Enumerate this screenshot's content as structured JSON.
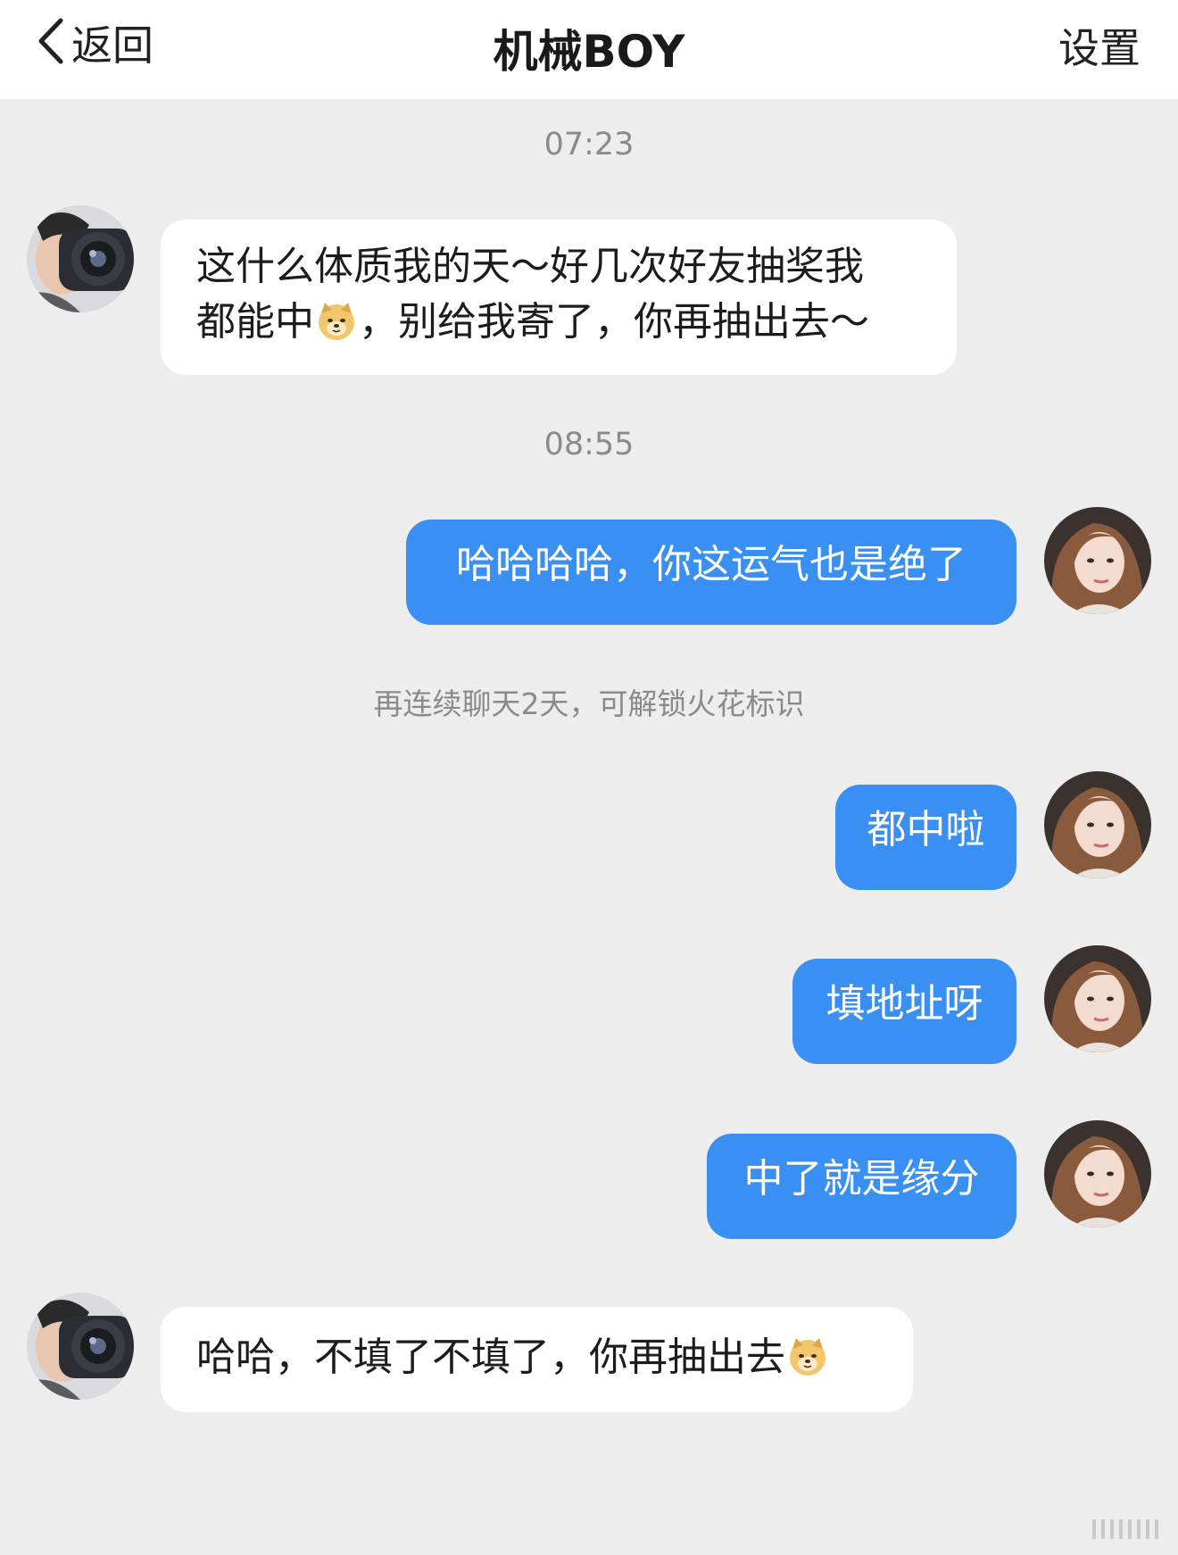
{
  "header": {
    "back_label": "返回",
    "title": "机械BOY",
    "settings_label": "设置"
  },
  "timestamps": [
    "07:23",
    "08:55"
  ],
  "system_notice": "再连续聊天2天，可解锁火花标识",
  "messages": [
    {
      "sender": "机械BOY",
      "lines": [
        "这什么体质我的天～好几次好友抽奖我",
        "都能中",
        "，别给我寄了，你再抽出去～"
      ]
    },
    {
      "sender": "me",
      "text": "哈哈哈哈，你这运气也是绝了"
    },
    {
      "sender": "me",
      "text": "都中啦"
    },
    {
      "sender": "me",
      "text": "填地址呀"
    },
    {
      "sender": "me",
      "text": "中了就是缘分"
    },
    {
      "sender": "机械BOY",
      "text": "哈哈，不填了不填了，你再抽出去"
    }
  ],
  "icons": {
    "back": "chevron-left-icon",
    "emoji": "doge-emoji-icon",
    "avatar_other": "camera-man-avatar",
    "avatar_me": "woman-avatar"
  },
  "colors": {
    "outgoing_bubble": "#3a8ff3",
    "incoming_bubble": "#ffffff",
    "background": "#ededed"
  }
}
